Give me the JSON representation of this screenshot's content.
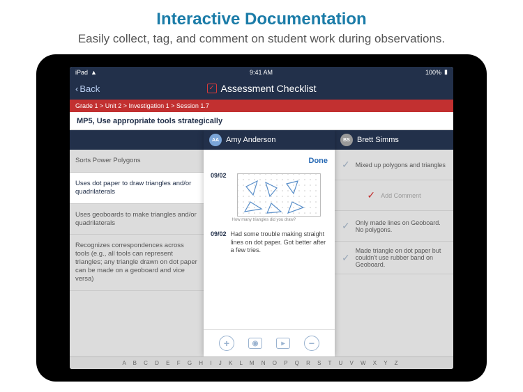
{
  "promo": {
    "title": "Interactive Documentation",
    "subtitle": "Easily collect, tag, and comment on student work during observations."
  },
  "status": {
    "carrier": "iPad",
    "time": "9:41 AM",
    "battery": "100%"
  },
  "nav": {
    "back": "Back",
    "title": "Assessment Checklist"
  },
  "breadcrumb": "Grade 1 > Unit 2 > Investigation 1 > Session 1.7",
  "standard": "MP5, Use appropriate tools strategically",
  "criteria": [
    "Sorts Power Polygons",
    "Uses dot paper to draw triangles and/or quadrilaterals",
    "Uses geoboards to make triangles and/or quadrilaterals",
    "Recognizes correspondences across tools (e.g., all tools can represent triangles; any triangle drawn on dot paper can be made on a geoboard and vice versa)"
  ],
  "student_a": {
    "initials": "AA",
    "name": "Amy Anderson",
    "done": "Done",
    "entries": {
      "date1": "09/02",
      "caption1": "How many triangles did you draw?",
      "date2": "09/02",
      "text2": "Had some trouble making straight lines on dot paper. Got better after a few tries."
    }
  },
  "student_b": {
    "initials": "BS",
    "name": "Brett Simms",
    "comments": [
      "Mixed up polygons and triangles",
      "Add Comment",
      "Only made lines on Geoboard. No polygons.",
      "Made triangle on dot paper but couldn't use rubber band on Geoboard."
    ]
  },
  "alphabet": "A B C D E F G H I J K L M N O P Q R S T U V W X Y Z"
}
